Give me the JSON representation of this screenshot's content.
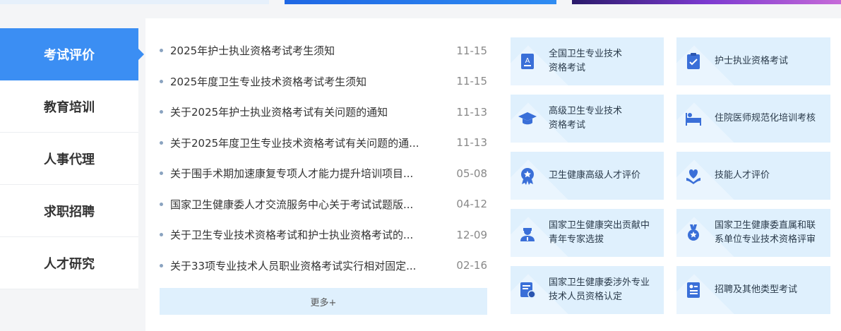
{
  "nav": {
    "items": [
      {
        "label": "考试评价",
        "active": true
      },
      {
        "label": "教育培训",
        "active": false
      },
      {
        "label": "人事代理",
        "active": false
      },
      {
        "label": "求职招聘",
        "active": false
      },
      {
        "label": "人才研究",
        "active": false
      }
    ]
  },
  "news": {
    "items": [
      {
        "title": "2025年护士执业资格考试考生须知",
        "date": "11-15"
      },
      {
        "title": "2025年度卫生专业技术资格考试考生须知",
        "date": "11-15"
      },
      {
        "title": "关于2025年护士执业资格考试有关问题的通知",
        "date": "11-13"
      },
      {
        "title": "关于2025年度卫生专业技术资格考试有关问题的通...",
        "date": "11-13"
      },
      {
        "title": "关于围手术期加速康复专项人才能力提升培训项目...",
        "date": "05-08"
      },
      {
        "title": "国家卫生健康委人才交流服务中心关于考试试题版...",
        "date": "04-12"
      },
      {
        "title": "关于卫生专业技术资格考试和护士执业资格考试的...",
        "date": "12-09"
      },
      {
        "title": "关于33项专业技术人员职业资格考试实行相对固定...",
        "date": "02-16"
      }
    ],
    "more_label": "更多+"
  },
  "tiles": [
    {
      "line1": "全国卫生专业技术",
      "line2": "资格考试",
      "icon": "exam-doc-icon"
    },
    {
      "line1": "护士执业资格考试",
      "line2": "",
      "icon": "clipboard-check-icon"
    },
    {
      "line1": "高级卫生专业技术",
      "line2": "资格考试",
      "icon": "graduation-cap-icon"
    },
    {
      "line1": "住院医师规范化培训考核",
      "line2": "",
      "icon": "hospital-bed-icon"
    },
    {
      "line1": "卫生健康高级人才评价",
      "line2": "",
      "icon": "award-badge-icon"
    },
    {
      "line1": "技能人才评价",
      "line2": "",
      "icon": "heart-hands-icon"
    },
    {
      "line1": "国家卫生健康突出贡献中",
      "line2": "青年专家选拔",
      "icon": "doctor-icon"
    },
    {
      "line1": "国家卫生健康委直属和联",
      "line2": "系单位专业技术资格评审",
      "icon": "medal-icon"
    },
    {
      "line1": "国家卫生健康委涉外专业",
      "line2": "技术人员资格认定",
      "icon": "certificate-icon"
    },
    {
      "line1": "招聘及其他类型考试",
      "line2": "",
      "icon": "resume-icon"
    }
  ],
  "colors": {
    "accent": "#3b8ef3",
    "tile_bg": "#dff0fd",
    "icon": "#3a6fd8"
  }
}
